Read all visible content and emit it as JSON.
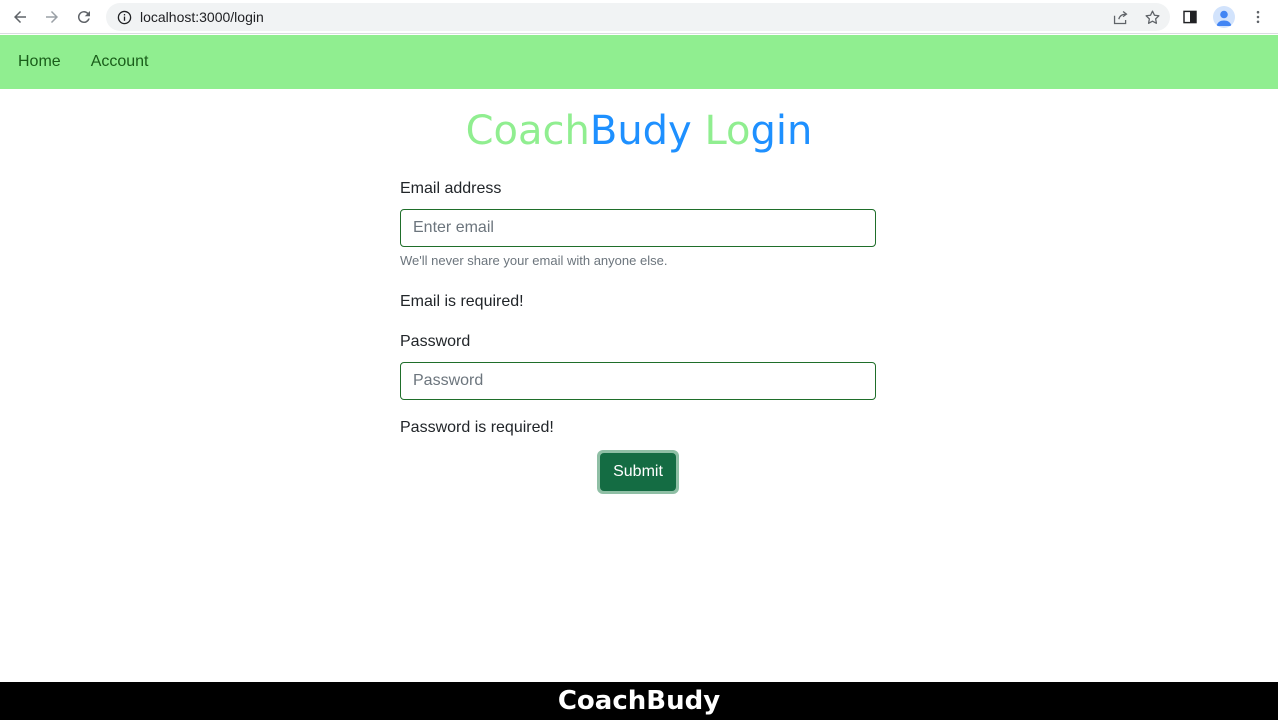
{
  "browser": {
    "url": "localhost:3000/login",
    "icons": [
      "back-arrow-icon",
      "forward-arrow-icon",
      "reload-icon",
      "info-icon",
      "share-icon",
      "star-icon",
      "side-panel-icon",
      "profile-avatar-icon",
      "more-vert-icon"
    ]
  },
  "navbar": {
    "items": [
      {
        "label": "Home"
      },
      {
        "label": "Account"
      }
    ],
    "background": "#90ee90"
  },
  "title": {
    "part1": "Coach",
    "part2": "Budy",
    "part3": "Lo",
    "part4": "gin",
    "green": "#90ee90",
    "blue": "#1e90ff"
  },
  "form": {
    "email_label": "Email address",
    "email_placeholder": "Enter email",
    "email_value": "",
    "email_help": "We'll never share your email with anyone else.",
    "email_error": "Email is required!",
    "password_label": "Password",
    "password_placeholder": "Password",
    "password_value": "",
    "password_error": "Password is required!",
    "submit_label": "Submit",
    "submit_color": "#146c43"
  },
  "footer": {
    "text": "CoachBudy"
  }
}
